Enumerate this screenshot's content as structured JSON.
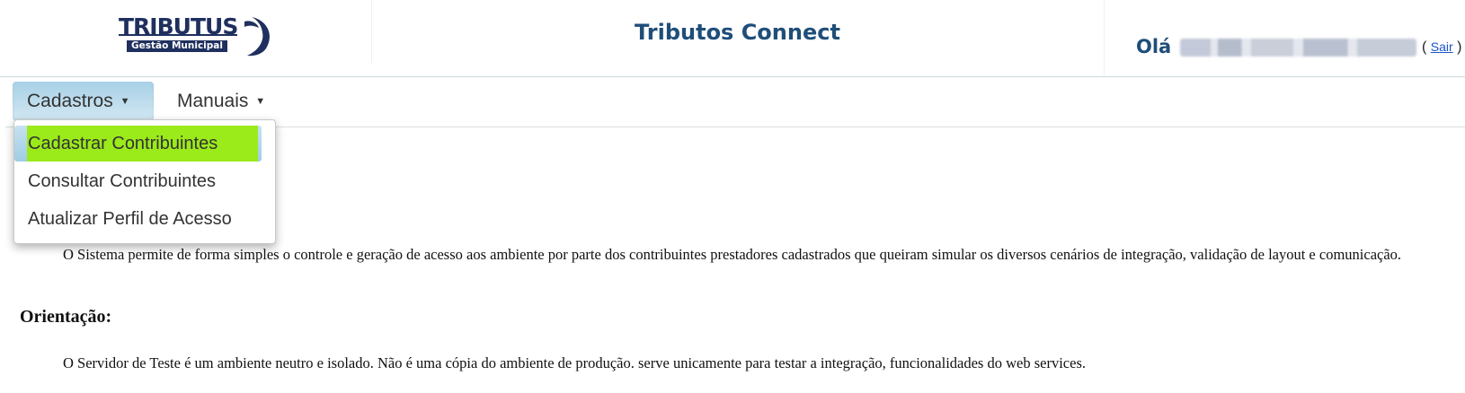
{
  "header": {
    "logo": {
      "word": "TRIBUTUS",
      "tagline": "Gestão Municipal"
    },
    "app_title": "Tributos Connect",
    "user": {
      "greeting": "Olá",
      "paren_open": "(",
      "logout_label": "Sair",
      "paren_close": ")"
    }
  },
  "menubar": {
    "items": [
      {
        "label": "Cadastros",
        "icon": "caret-down-icon"
      },
      {
        "label": "Manuais",
        "icon": "caret-down-icon"
      }
    ]
  },
  "dropdown": {
    "items": [
      {
        "label": "Cadastrar Contribuintes"
      },
      {
        "label": "Consultar Contribuintes"
      },
      {
        "label": "Atualizar Perfil de Acesso"
      }
    ]
  },
  "content": {
    "paragraph1": "O Sistema permite de forma simples o controle e geração de acesso aos ambiente por parte dos contribuintes prestadores cadastrados que queiram simular os diversos cenários de integração, validação de layout e comunicação.",
    "heading": "Orientação:",
    "paragraph2": "O Servidor de Teste é um ambiente neutro e isolado. Não é uma cópia do ambiente de produção. serve unicamente para testar a integração, funcionalidades do web services."
  },
  "colors": {
    "accent": "#1f4e79",
    "logo_navy": "#1f2f5e",
    "highlight": "#9bea1a",
    "menu_active": "#a8d0e6",
    "link": "#1a55c9"
  }
}
